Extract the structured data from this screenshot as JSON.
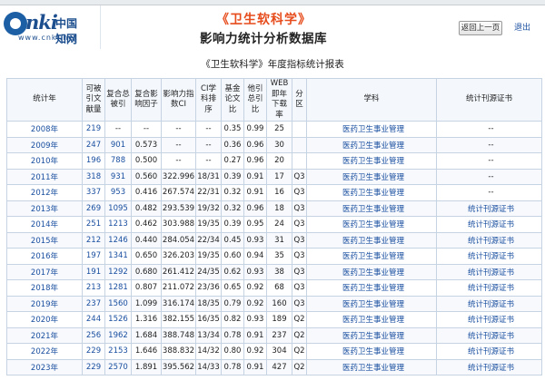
{
  "header": {
    "logo_cn": "中国知网",
    "logo_www": "www.cnki.net",
    "journal_title": "《卫生软科学》",
    "subtitle": "影响力统计分析数据库",
    "back_label": "返回上一页",
    "exit_label": "退出"
  },
  "report_title": "《卫生软科学》年度指标统计报表",
  "columns": [
    "统计年",
    "可被引文献量",
    "复合总被引",
    "复合影响因子",
    "影响力指数CI",
    "CI学科排序",
    "基金论文比",
    "他引总引比",
    "WEB即年下载率",
    "分区",
    "学科",
    "统计刊源证书"
  ],
  "rows": [
    {
      "year": "2008年",
      "citable": "219",
      "total_cites": "--",
      "impact": "--",
      "ci": "--",
      "rank": "--",
      "fund": "0.35",
      "other": "0.99",
      "web": "25",
      "zone": "",
      "subject": "医药卫生事业管理",
      "cert": "--"
    },
    {
      "year": "2009年",
      "citable": "247",
      "total_cites": "901",
      "impact": "0.573",
      "ci": "--",
      "rank": "--",
      "fund": "0.36",
      "other": "0.96",
      "web": "30",
      "zone": "",
      "subject": "医药卫生事业管理",
      "cert": "--"
    },
    {
      "year": "2010年",
      "citable": "196",
      "total_cites": "788",
      "impact": "0.500",
      "ci": "--",
      "rank": "--",
      "fund": "0.27",
      "other": "0.96",
      "web": "20",
      "zone": "",
      "subject": "医药卫生事业管理",
      "cert": "--"
    },
    {
      "year": "2011年",
      "citable": "318",
      "total_cites": "931",
      "impact": "0.560",
      "ci": "322.996",
      "rank": "18/31",
      "fund": "0.39",
      "other": "0.91",
      "web": "17",
      "zone": "Q3",
      "subject": "医药卫生事业管理",
      "cert": "--"
    },
    {
      "year": "2012年",
      "citable": "337",
      "total_cites": "953",
      "impact": "0.416",
      "ci": "267.574",
      "rank": "22/31",
      "fund": "0.32",
      "other": "0.91",
      "web": "16",
      "zone": "Q3",
      "subject": "医药卫生事业管理",
      "cert": "--"
    },
    {
      "year": "2013年",
      "citable": "269",
      "total_cites": "1095",
      "impact": "0.482",
      "ci": "293.539",
      "rank": "19/32",
      "fund": "0.32",
      "other": "0.96",
      "web": "18",
      "zone": "Q3",
      "subject": "医药卫生事业管理",
      "cert": "统计刊源证书"
    },
    {
      "year": "2014年",
      "citable": "251",
      "total_cites": "1213",
      "impact": "0.462",
      "ci": "303.988",
      "rank": "19/35",
      "fund": "0.39",
      "other": "0.95",
      "web": "24",
      "zone": "Q3",
      "subject": "医药卫生事业管理",
      "cert": "统计刊源证书"
    },
    {
      "year": "2015年",
      "citable": "212",
      "total_cites": "1246",
      "impact": "0.440",
      "ci": "284.054",
      "rank": "22/34",
      "fund": "0.45",
      "other": "0.93",
      "web": "31",
      "zone": "Q3",
      "subject": "医药卫生事业管理",
      "cert": "统计刊源证书"
    },
    {
      "year": "2016年",
      "citable": "197",
      "total_cites": "1341",
      "impact": "0.650",
      "ci": "326.203",
      "rank": "19/35",
      "fund": "0.60",
      "other": "0.94",
      "web": "35",
      "zone": "Q3",
      "subject": "医药卫生事业管理",
      "cert": "统计刊源证书"
    },
    {
      "year": "2017年",
      "citable": "191",
      "total_cites": "1292",
      "impact": "0.680",
      "ci": "261.412",
      "rank": "24/35",
      "fund": "0.62",
      "other": "0.93",
      "web": "38",
      "zone": "Q3",
      "subject": "医药卫生事业管理",
      "cert": "统计刊源证书"
    },
    {
      "year": "2018年",
      "citable": "213",
      "total_cites": "1281",
      "impact": "0.807",
      "ci": "211.072",
      "rank": "23/36",
      "fund": "0.65",
      "other": "0.92",
      "web": "68",
      "zone": "Q3",
      "subject": "医药卫生事业管理",
      "cert": "统计刊源证书"
    },
    {
      "year": "2019年",
      "citable": "237",
      "total_cites": "1560",
      "impact": "1.099",
      "ci": "316.174",
      "rank": "18/35",
      "fund": "0.79",
      "other": "0.92",
      "web": "160",
      "zone": "Q3",
      "subject": "医药卫生事业管理",
      "cert": "统计刊源证书"
    },
    {
      "year": "2020年",
      "citable": "244",
      "total_cites": "1526",
      "impact": "1.316",
      "ci": "382.155",
      "rank": "16/35",
      "fund": "0.82",
      "other": "0.93",
      "web": "189",
      "zone": "Q2",
      "subject": "医药卫生事业管理",
      "cert": "统计刊源证书"
    },
    {
      "year": "2021年",
      "citable": "256",
      "total_cites": "1962",
      "impact": "1.684",
      "ci": "388.748",
      "rank": "13/34",
      "fund": "0.78",
      "other": "0.91",
      "web": "237",
      "zone": "Q2",
      "subject": "医药卫生事业管理",
      "cert": "统计刊源证书"
    },
    {
      "year": "2022年",
      "citable": "229",
      "total_cites": "2153",
      "impact": "1.646",
      "ci": "388.832",
      "rank": "14/32",
      "fund": "0.80",
      "other": "0.92",
      "web": "304",
      "zone": "Q2",
      "subject": "医药卫生事业管理",
      "cert": "统计刊源证书"
    },
    {
      "year": "2023年",
      "citable": "229",
      "total_cites": "2570",
      "impact": "1.891",
      "ci": "395.562",
      "rank": "14/33",
      "fund": "0.78",
      "other": "0.91",
      "web": "427",
      "zone": "Q2",
      "subject": "医药卫生事业管理",
      "cert": "统计刊源证书"
    }
  ],
  "colors": {
    "link": "#1a4fa0",
    "journal_title": "#e64c1c",
    "logo": "#1d4f8f"
  }
}
